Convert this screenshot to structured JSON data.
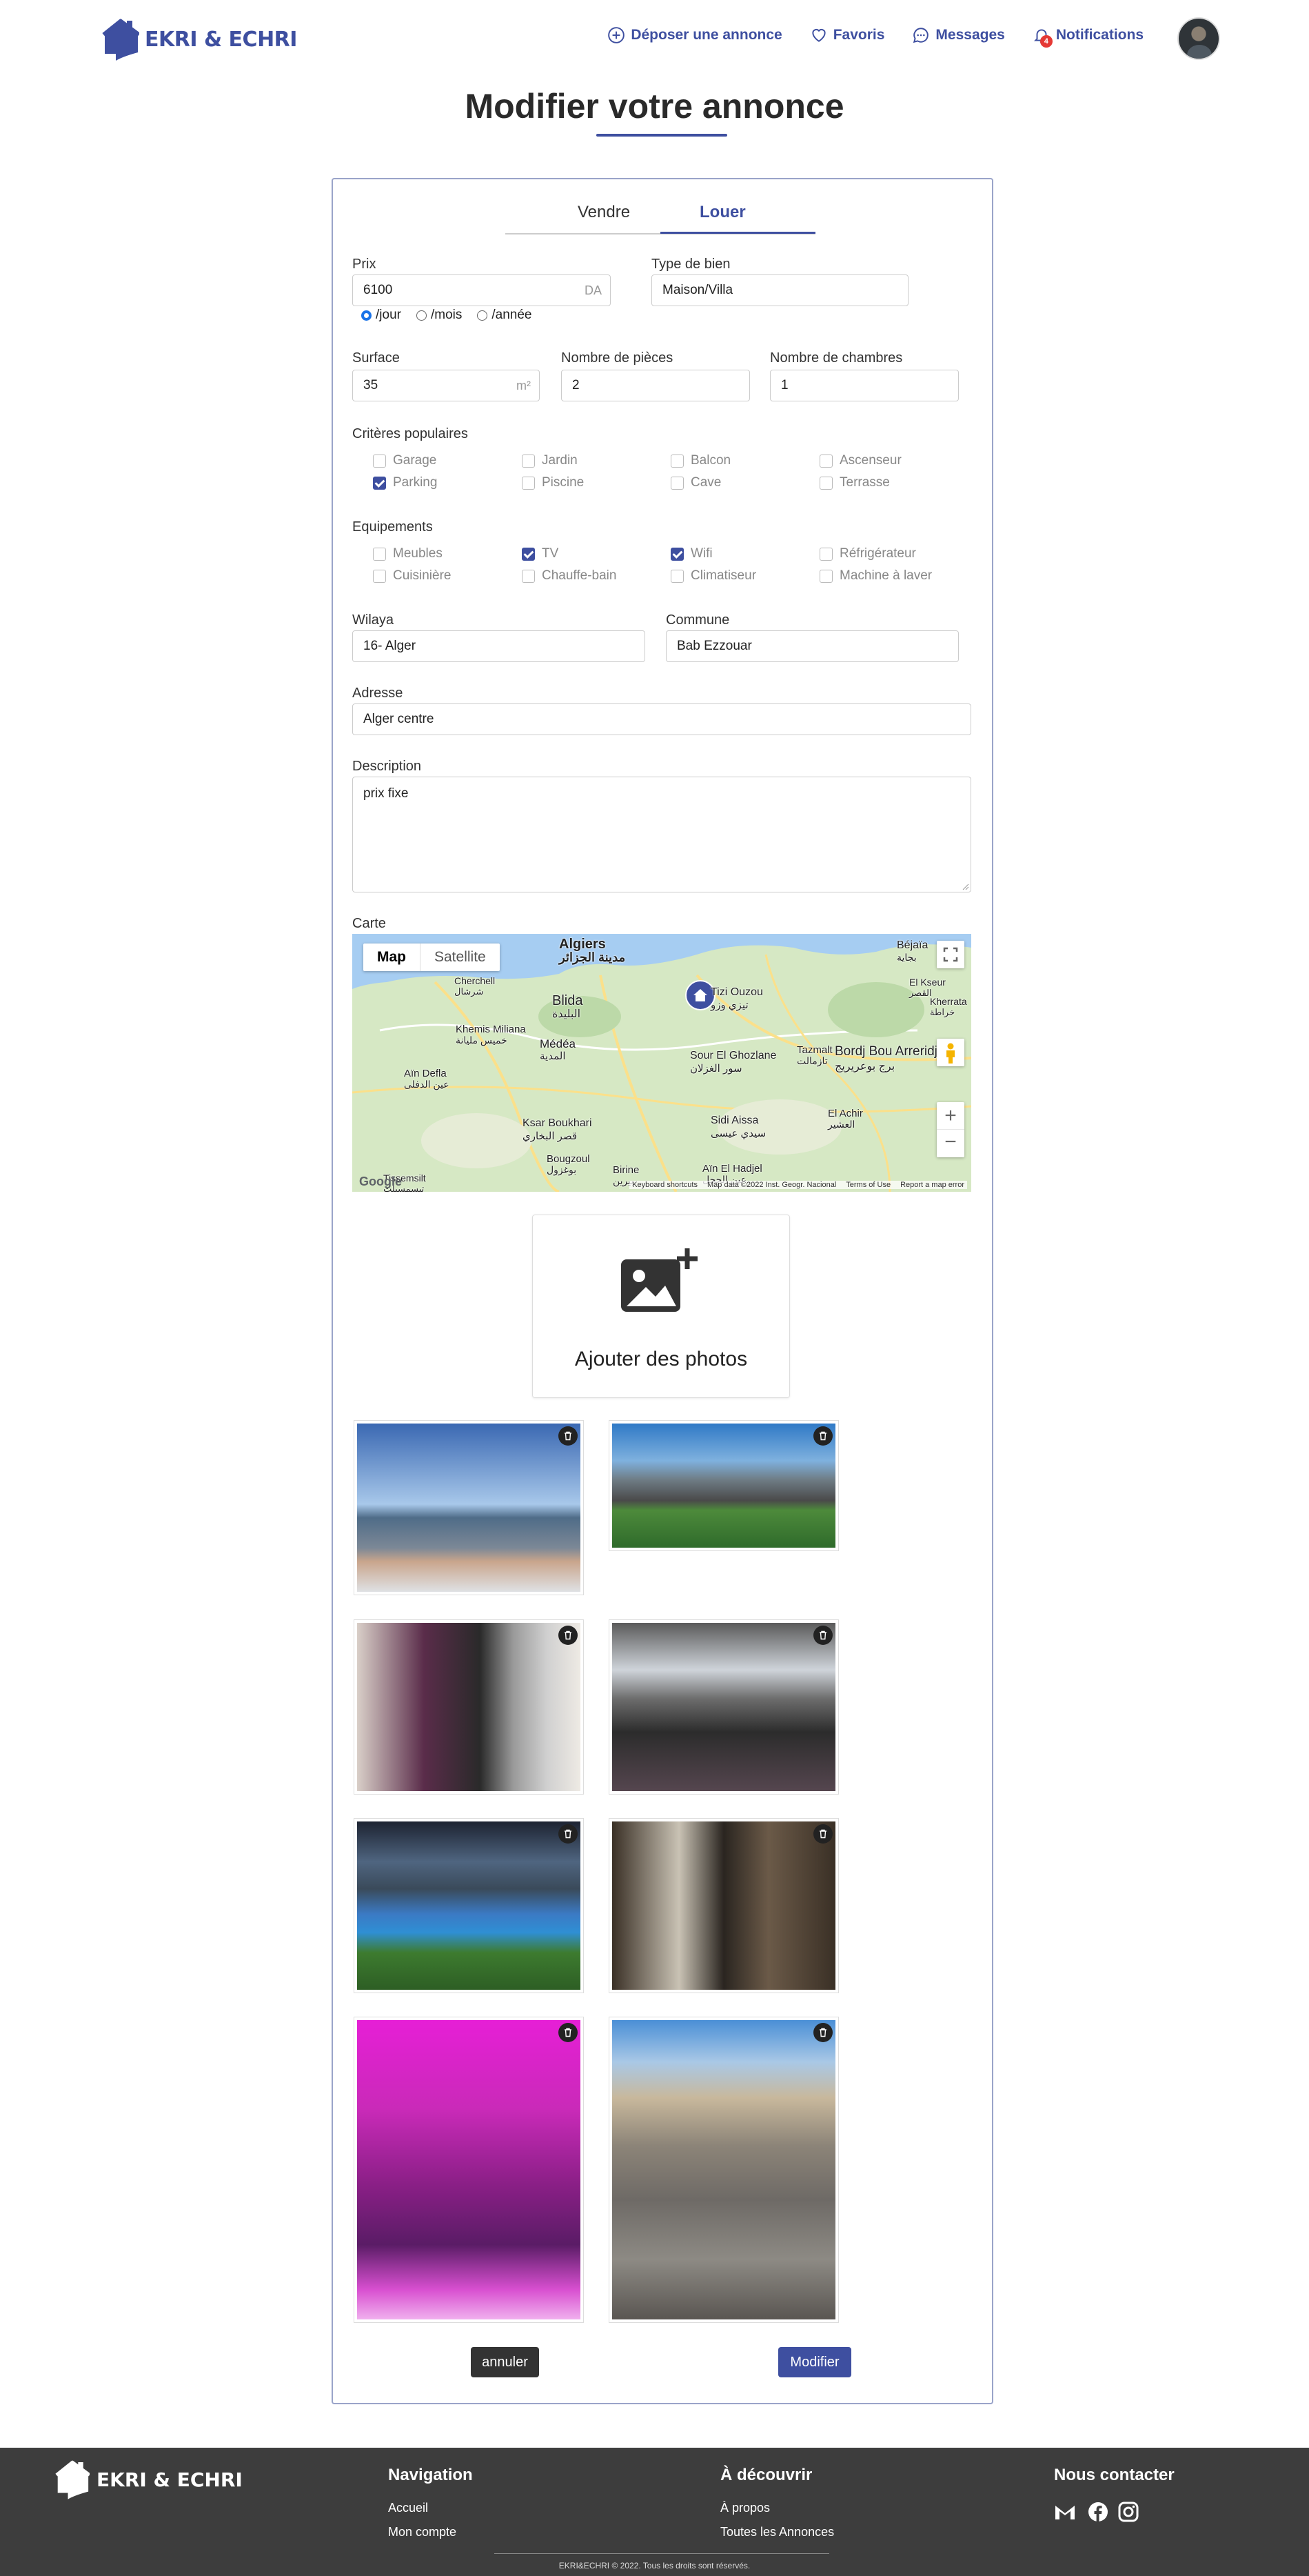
{
  "brand": {
    "name": "EKRI & ECHRI",
    "accent": "#3e4fa0"
  },
  "nav": {
    "post": "Déposer une annonce",
    "favorites": "Favoris",
    "messages": "Messages",
    "notifications": "Notifications",
    "notif_count": "4"
  },
  "page": {
    "title": "Modifier votre annonce"
  },
  "tabs": {
    "sell": "Vendre",
    "rent": "Louer",
    "active": "rent"
  },
  "form": {
    "price_label": "Prix",
    "price_value": "6100",
    "price_unit": "DA",
    "period_options": [
      "/jour",
      "/mois",
      "/année"
    ],
    "period_selected": "/jour",
    "type_label": "Type de bien",
    "type_value": "Maison/Villa",
    "surface_label": "Surface",
    "surface_value": "35",
    "surface_unit": "m²",
    "rooms_label": "Nombre de pièces",
    "rooms_value": "2",
    "bedrooms_label": "Nombre de chambres",
    "bedrooms_value": "1",
    "criteria_label": "Critères populaires",
    "criteria": [
      {
        "label": "Garage",
        "checked": false
      },
      {
        "label": "Jardin",
        "checked": false
      },
      {
        "label": "Balcon",
        "checked": false
      },
      {
        "label": "Ascenseur",
        "checked": false
      },
      {
        "label": "Parking",
        "checked": true
      },
      {
        "label": "Piscine",
        "checked": false
      },
      {
        "label": "Cave",
        "checked": false
      },
      {
        "label": "Terrasse",
        "checked": false
      }
    ],
    "equipment_label": "Equipements",
    "equipment": [
      {
        "label": "Meubles",
        "checked": false
      },
      {
        "label": "TV",
        "checked": true
      },
      {
        "label": "Wifi",
        "checked": true
      },
      {
        "label": "Réfrigérateur",
        "checked": false
      },
      {
        "label": "Cuisinière",
        "checked": false
      },
      {
        "label": "Chauffe-bain",
        "checked": false
      },
      {
        "label": "Climatiseur",
        "checked": false
      },
      {
        "label": "Machine à laver",
        "checked": false
      }
    ],
    "wilaya_label": "Wilaya",
    "wilaya_value": "16- Alger",
    "commune_label": "Commune",
    "commune_value": "Bab Ezzouar",
    "address_label": "Adresse",
    "address_value": "Alger centre",
    "description_label": "Description",
    "description_value": "prix fixe",
    "map_label": "Carte"
  },
  "map": {
    "type_map": "Map",
    "type_satellite": "Satellite",
    "places": [
      "Algiers",
      "مدينة الجزائر",
      "Blida",
      "البليدة",
      "Médéa",
      "المدية",
      "Tizi Ouzou",
      "تيزي وزو",
      "Bordj Bou Arreridj",
      "برج بوعريريج",
      "Sour El Ghozlane",
      "سور الغزلان",
      "Ksar Boukhari",
      "قصر البخاري",
      "Aïn Defla",
      "عين الدفلى",
      "Khemis Miliana",
      "خميس مليانة",
      "Sidi Aissa",
      "سيدي عيسى",
      "Cherchell",
      "شرشال",
      "Tazmalt",
      "تازمالت",
      "El Achir",
      "العشير",
      "Aïn El Hadjel",
      "عين الحجل",
      "Bougzoul",
      "بوغزول",
      "Birine",
      "بيرين",
      "Tissemsilt",
      "تيسمسيلت",
      "Béjaïa",
      "بجاية",
      "Kherrata",
      "خراطة",
      "El Kseur",
      "القصر"
    ],
    "shortcuts": "Keyboard shortcuts",
    "map_data": "Map data ©2022 Inst. Geogr. Nacional",
    "terms": "Terms of Use",
    "report": "Report a map error",
    "google": "Google"
  },
  "photos": {
    "add_label": "Ajouter des photos",
    "count": 8
  },
  "actions": {
    "cancel": "annuler",
    "submit": "Modifier",
    "cancel_color": "#333333",
    "submit_color": "#3e4fa0"
  },
  "footer": {
    "nav_title": "Navigation",
    "nav_links": [
      "Accueil",
      "Mon compte"
    ],
    "discover_title": "À découvrir",
    "discover_links": [
      "À propos",
      "Toutes les Annonces"
    ],
    "contact_title": "Nous contacter",
    "copyright": "EKRI&ECHRI © 2022. Tous les droits sont réservés."
  }
}
